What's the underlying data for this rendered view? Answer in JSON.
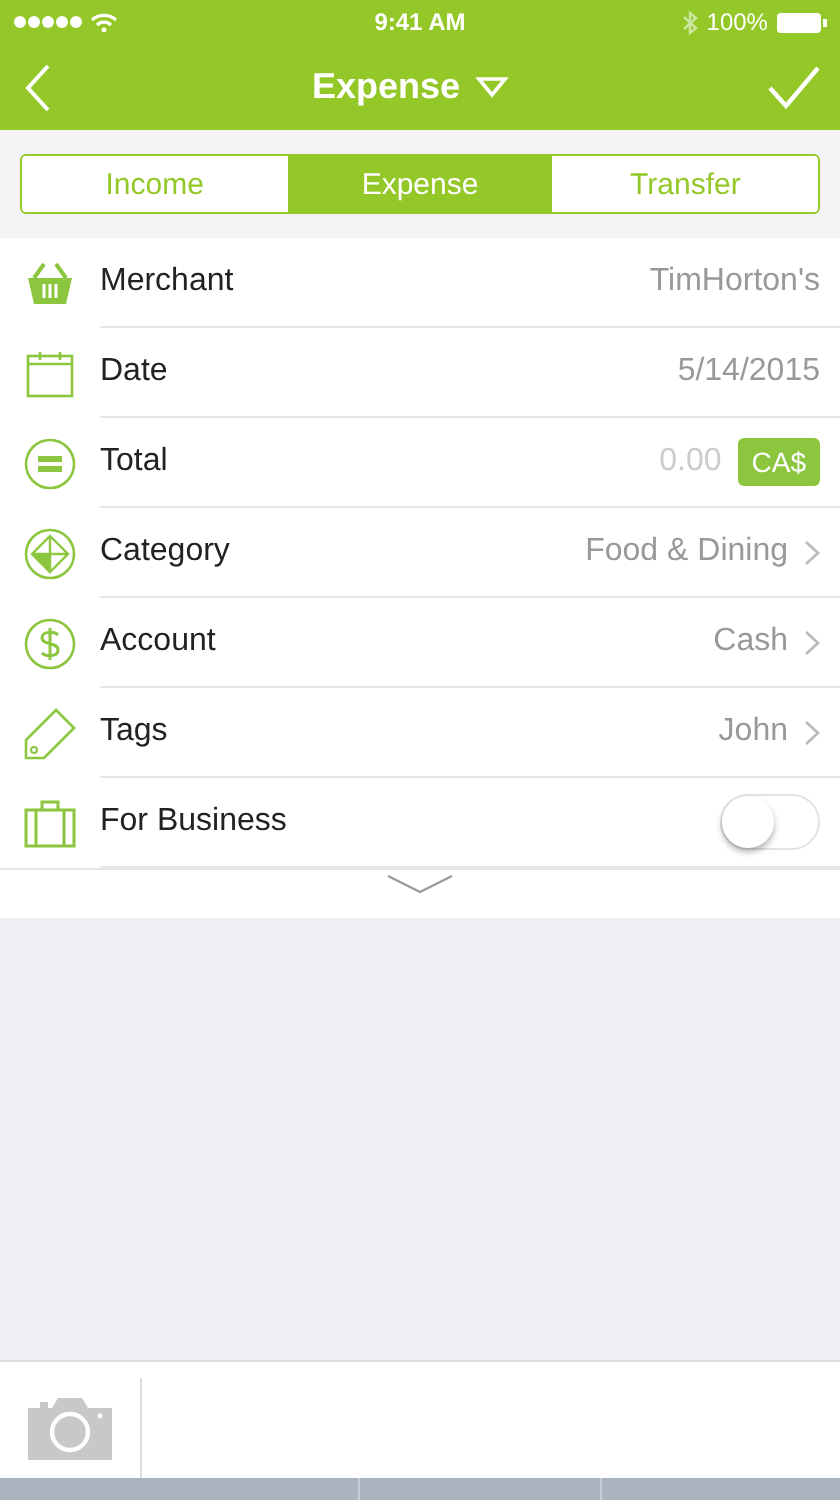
{
  "status_bar": {
    "time": "9:41 AM",
    "battery": "100%"
  },
  "nav": {
    "title": "Expense"
  },
  "tabs": [
    {
      "label": "Income",
      "selected": false
    },
    {
      "label": "Expense",
      "selected": true
    },
    {
      "label": "Transfer",
      "selected": false
    }
  ],
  "rows": [
    {
      "kind": "text",
      "label": "Merchant",
      "value": "TimHorton's"
    },
    {
      "kind": "text",
      "label": "Date",
      "value": "5/14/2015"
    },
    {
      "kind": "amount",
      "label": "Total",
      "placeholder": "0.00",
      "currency": "CA$"
    },
    {
      "kind": "link",
      "label": "Category",
      "value": "Food & Dining"
    },
    {
      "kind": "link",
      "label": "Account",
      "value": "Cash"
    },
    {
      "kind": "link",
      "label": "Tags",
      "value": "John"
    },
    {
      "kind": "toggle",
      "label": "For Business",
      "on": false
    }
  ]
}
